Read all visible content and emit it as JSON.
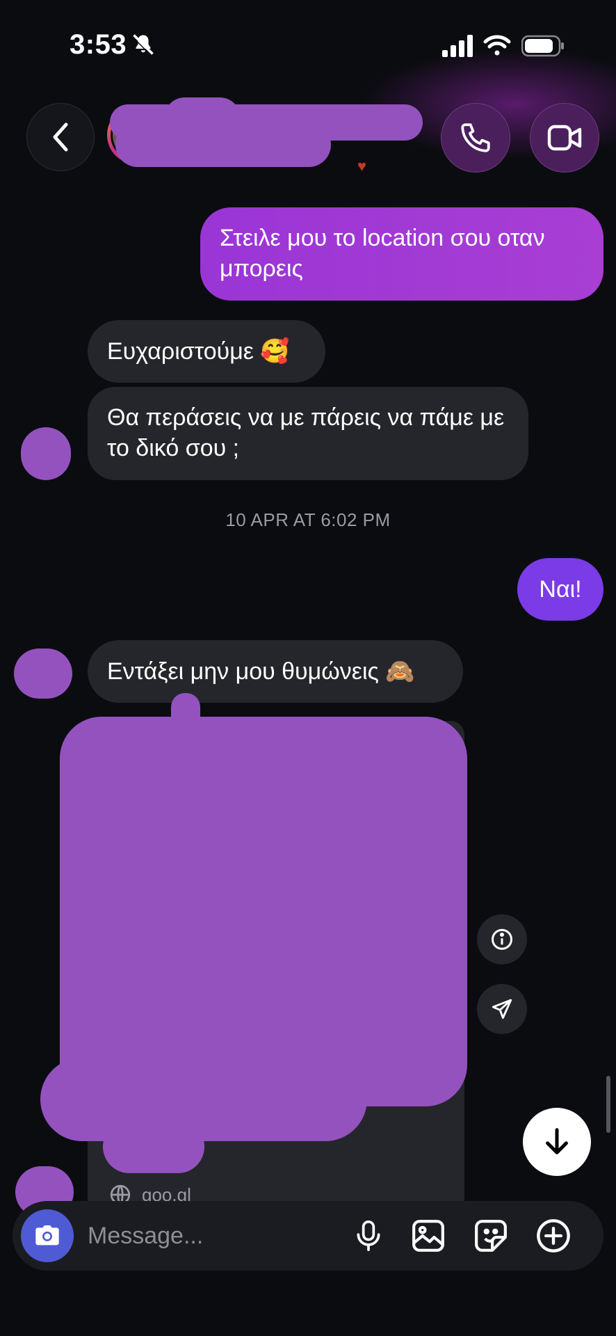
{
  "status_bar": {
    "time": "3:53"
  },
  "messages": [
    {
      "id": 1,
      "direction": "sent",
      "text": "Στειλε μου το location σου οταν μπορεις"
    },
    {
      "id": 2,
      "direction": "received",
      "text": "Ευχαριστούμε 🥰"
    },
    {
      "id": 3,
      "direction": "received",
      "text": "Θα περάσεις να με πάρεις να πάμε με το  δικό σου ;"
    },
    {
      "id": 4,
      "direction": "sent",
      "text": "Ναι!"
    },
    {
      "id": 5,
      "direction": "received",
      "text": "Εντάξει μην μου θυμώνεις 🙈"
    }
  ],
  "timestamp": "10 APR AT 6:02 PM",
  "shared_link": {
    "domain": "goo.gl"
  },
  "composer": {
    "placeholder": "Message..."
  },
  "colors": {
    "sent_bubble": "#a33ad6",
    "received_bubble": "#25262b",
    "accent_blue": "#4f5bd5",
    "redaction": "#9452bf"
  }
}
